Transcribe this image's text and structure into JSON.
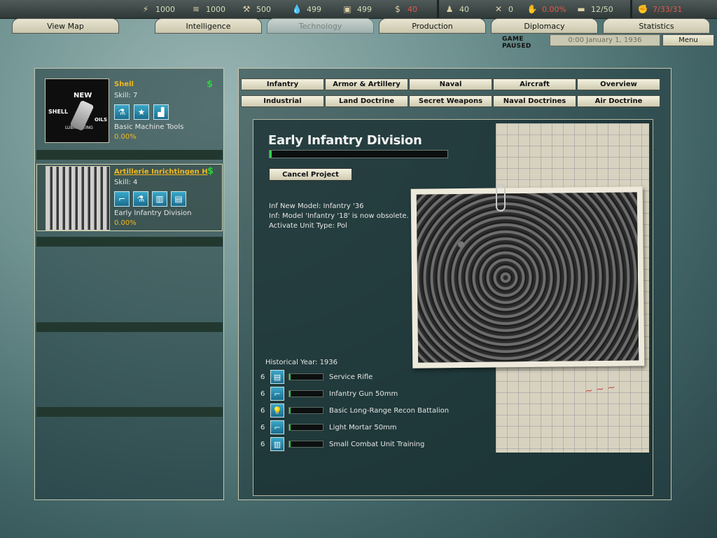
{
  "resources": [
    {
      "icon": "energy-icon",
      "glyph": "⚡",
      "value": "1000"
    },
    {
      "icon": "metal-icon",
      "glyph": "≋",
      "value": "1000"
    },
    {
      "icon": "rare-materials-icon",
      "glyph": "⚒",
      "value": "500"
    },
    {
      "icon": "oil-icon",
      "glyph": "💧",
      "value": "499"
    },
    {
      "icon": "supplies-icon",
      "glyph": "▣",
      "value": "499"
    },
    {
      "icon": "money-icon",
      "glyph": "$",
      "value": "40"
    }
  ],
  "stats": [
    {
      "icon": "manpower-icon",
      "glyph": "♟",
      "value": "40"
    },
    {
      "icon": "diplomacy-icon",
      "glyph": "✕",
      "value": "0"
    },
    {
      "icon": "dissent-icon",
      "glyph": "✋",
      "value": "0.00%"
    },
    {
      "icon": "transport-icon",
      "glyph": "▬",
      "value": "12/50"
    },
    {
      "icon": "officers-icon",
      "glyph": "✊",
      "value": "7/33/31"
    }
  ],
  "tabs": [
    "View Map",
    "Intelligence",
    "Technology",
    "Production",
    "Diplomacy",
    "Statistics"
  ],
  "status": {
    "paused": "GAME PAUSED",
    "date": "0:00 January 1, 1936",
    "menu": "Menu"
  },
  "teams": [
    {
      "name": "Shell",
      "skill": "Skill: 7",
      "project": "Basic Machine Tools",
      "progress": "0.00%",
      "logo_text": [
        "NEW",
        "SHELL",
        "LUBRICATING",
        "OILS"
      ]
    },
    {
      "name": "Artillerie Inrichtingen H",
      "skill": "Skill: 4",
      "project": "Early Infantry Division",
      "progress": "0.00%"
    }
  ],
  "categories_row1": [
    "Infantry",
    "Armor & Artillery",
    "Naval",
    "Aircraft",
    "Overview"
  ],
  "categories_row2": [
    "Industrial",
    "Land Doctrine",
    "Secret Weapons",
    "Naval Doctrines",
    "Air Doctrine"
  ],
  "project": {
    "title": "Early Infantry Division",
    "progress_pct": 0,
    "cancel_label": "Cancel Project",
    "effects": [
      "Inf New Model: Infantry '36",
      "Inf: Model 'Infantry '18' is now obsolete.",
      "Activate Unit Type: Pol"
    ],
    "historical_year": "Historical Year: 1936",
    "requirements": [
      {
        "level": "6",
        "icon": "rifle-icon",
        "glyph": "▤",
        "name": "Service Rifle"
      },
      {
        "level": "6",
        "icon": "infantry-gun-icon",
        "glyph": "⌐",
        "name": "Infantry Gun 50mm"
      },
      {
        "level": "6",
        "icon": "lightbulb-icon",
        "glyph": "💡",
        "name": "Basic Long-Range Recon Battalion"
      },
      {
        "level": "6",
        "icon": "mortar-icon",
        "glyph": "⌐",
        "name": "Light Mortar 50mm"
      },
      {
        "level": "6",
        "icon": "book-icon",
        "glyph": "▥",
        "name": "Small Combat Unit Training"
      }
    ]
  }
}
